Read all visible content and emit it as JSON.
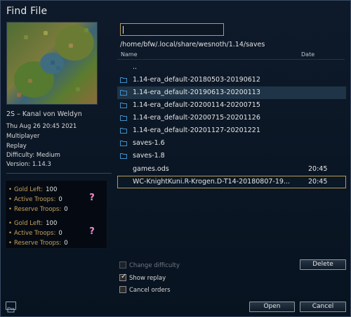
{
  "window": {
    "title": "Find File"
  },
  "scenario": {
    "name": "2S – Kanal von Weldyn",
    "date": "Thu Aug 26 20:45 2021",
    "mode": "Multiplayer",
    "type": "Replay",
    "difficulty": "Difficulty: Medium",
    "version": "Version: 1.14.3"
  },
  "sides": [
    {
      "gold_label": "Gold Left:",
      "gold": "100",
      "active_label": "Active Troops:",
      "active": "0",
      "reserve_label": "Reserve Troops:",
      "reserve": "0",
      "avatar": "?"
    },
    {
      "gold_label": "Gold Left:",
      "gold": "100",
      "active_label": "Active Troops:",
      "active": "0",
      "reserve_label": "Reserve Troops:",
      "reserve": "0",
      "avatar": "?"
    }
  ],
  "search": {
    "value": "",
    "placeholder": ""
  },
  "current_path": "/home/bfw/.local/share/wesnoth/1.14/saves",
  "columns": {
    "name": "Name",
    "date": "Date"
  },
  "files": [
    {
      "name": "..",
      "date": "",
      "icon": "none"
    },
    {
      "name": "1.14-era_default-20180503-20190612",
      "date": "",
      "icon": "folder-icon"
    },
    {
      "name": "1.14-era_default-20190613-20200113",
      "date": "",
      "icon": "folder-icon"
    },
    {
      "name": "1.14-era_default-20200114-20200715",
      "date": "",
      "icon": "folder-icon"
    },
    {
      "name": "1.14-era_default-20200715-20201126",
      "date": "",
      "icon": "folder-icon"
    },
    {
      "name": "1.14-era_default-20201127-20201221",
      "date": "",
      "icon": "folder-icon"
    },
    {
      "name": "saves-1.6",
      "date": "",
      "icon": "folder-icon"
    },
    {
      "name": "saves-1.8",
      "date": "",
      "icon": "folder-icon"
    },
    {
      "name": "games.ods",
      "date": "20:45",
      "icon": "none"
    },
    {
      "name": "WC-KnightKuni.R-Krogen.D-T14-20180807-19...",
      "date": "20:45",
      "icon": "none"
    }
  ],
  "options": {
    "change_difficulty": "Change difficulty",
    "show_replay": "Show replay",
    "cancel_orders": "Cancel orders"
  },
  "buttons": {
    "delete": "Delete",
    "open": "Open",
    "cancel": "Cancel"
  },
  "colors": {
    "accent": "#b69a5a",
    "folder": "#3f8fc9",
    "label": "#c4a25c",
    "avatar": "#f08bd0"
  }
}
